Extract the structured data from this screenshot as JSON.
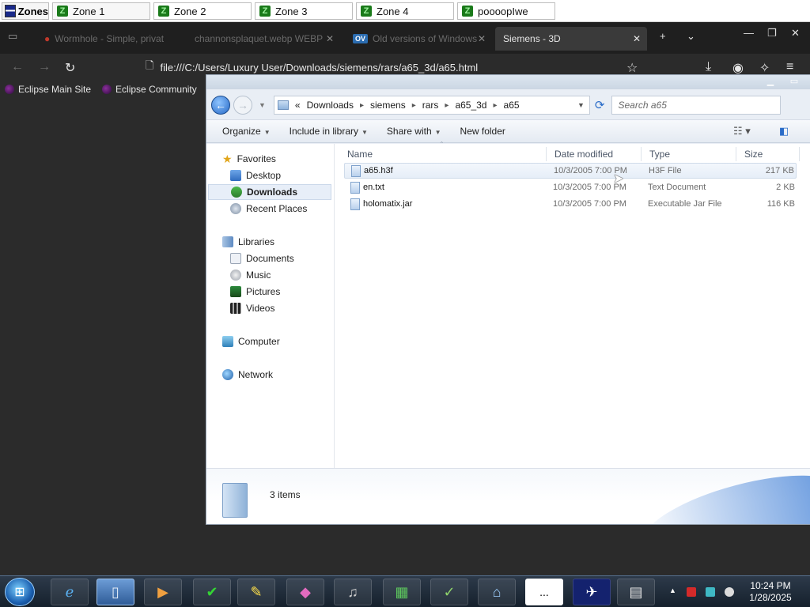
{
  "zones_bar": {
    "title": "Zones",
    "tabs": [
      {
        "label": "Zone 1"
      },
      {
        "label": "Zone 2"
      },
      {
        "label": "Zone 3"
      },
      {
        "label": "Zone 4"
      },
      {
        "label": "poooopIwe"
      }
    ]
  },
  "browser": {
    "tabs": [
      {
        "label": "Wormhole - Simple, privat",
        "icon": "wormhole-icon"
      },
      {
        "label": "channonsplaquet.webp WEBP",
        "icon": "image-icon"
      },
      {
        "label": "Old versions of Windows",
        "icon": "ov-icon",
        "icon_text": "OV"
      },
      {
        "label": "Siemens - 3D",
        "icon": "page-icon"
      }
    ],
    "url": "file:///C:/Users/Luxury User/Downloads/siemens/rars/a65_3d/a65.html",
    "bookmarks": [
      {
        "label": "Eclipse Main Site"
      },
      {
        "label": "Eclipse Community"
      }
    ]
  },
  "explorer": {
    "breadcrumb": [
      "Downloads",
      "siemens",
      "rars",
      "a65_3d",
      "a65"
    ],
    "breadcrumb_prefix": "«",
    "search_placeholder": "Search a65",
    "commands": {
      "organize": "Organize",
      "include_in_library": "Include in library",
      "share_with": "Share with",
      "new_folder": "New folder"
    },
    "nav": {
      "favorites": "Favorites",
      "desktop": "Desktop",
      "downloads": "Downloads",
      "recent_places": "Recent Places",
      "libraries": "Libraries",
      "documents": "Documents",
      "music": "Music",
      "pictures": "Pictures",
      "videos": "Videos",
      "computer": "Computer",
      "network": "Network"
    },
    "columns": {
      "name": "Name",
      "date_modified": "Date modified",
      "type": "Type",
      "size": "Size"
    },
    "files": [
      {
        "name": "a65.h3f",
        "date": "10/3/2005 7:00 PM",
        "type": "H3F File",
        "size": "217 KB"
      },
      {
        "name": "en.txt",
        "date": "10/3/2005 7:00 PM",
        "type": "Text Document",
        "size": "2 KB"
      },
      {
        "name": "holomatix.jar",
        "date": "10/3/2005 7:00 PM",
        "type": "Executable Jar File",
        "size": "116 KB"
      }
    ],
    "items_count": "3 items"
  },
  "taskbar": {
    "time": "10:24 PM",
    "date": "1/28/2025",
    "ellipsis_label": "..."
  },
  "colors": {
    "accent": "#2568c6",
    "browser_bg": "#2b2b2b",
    "selection": "#e7eef8"
  }
}
